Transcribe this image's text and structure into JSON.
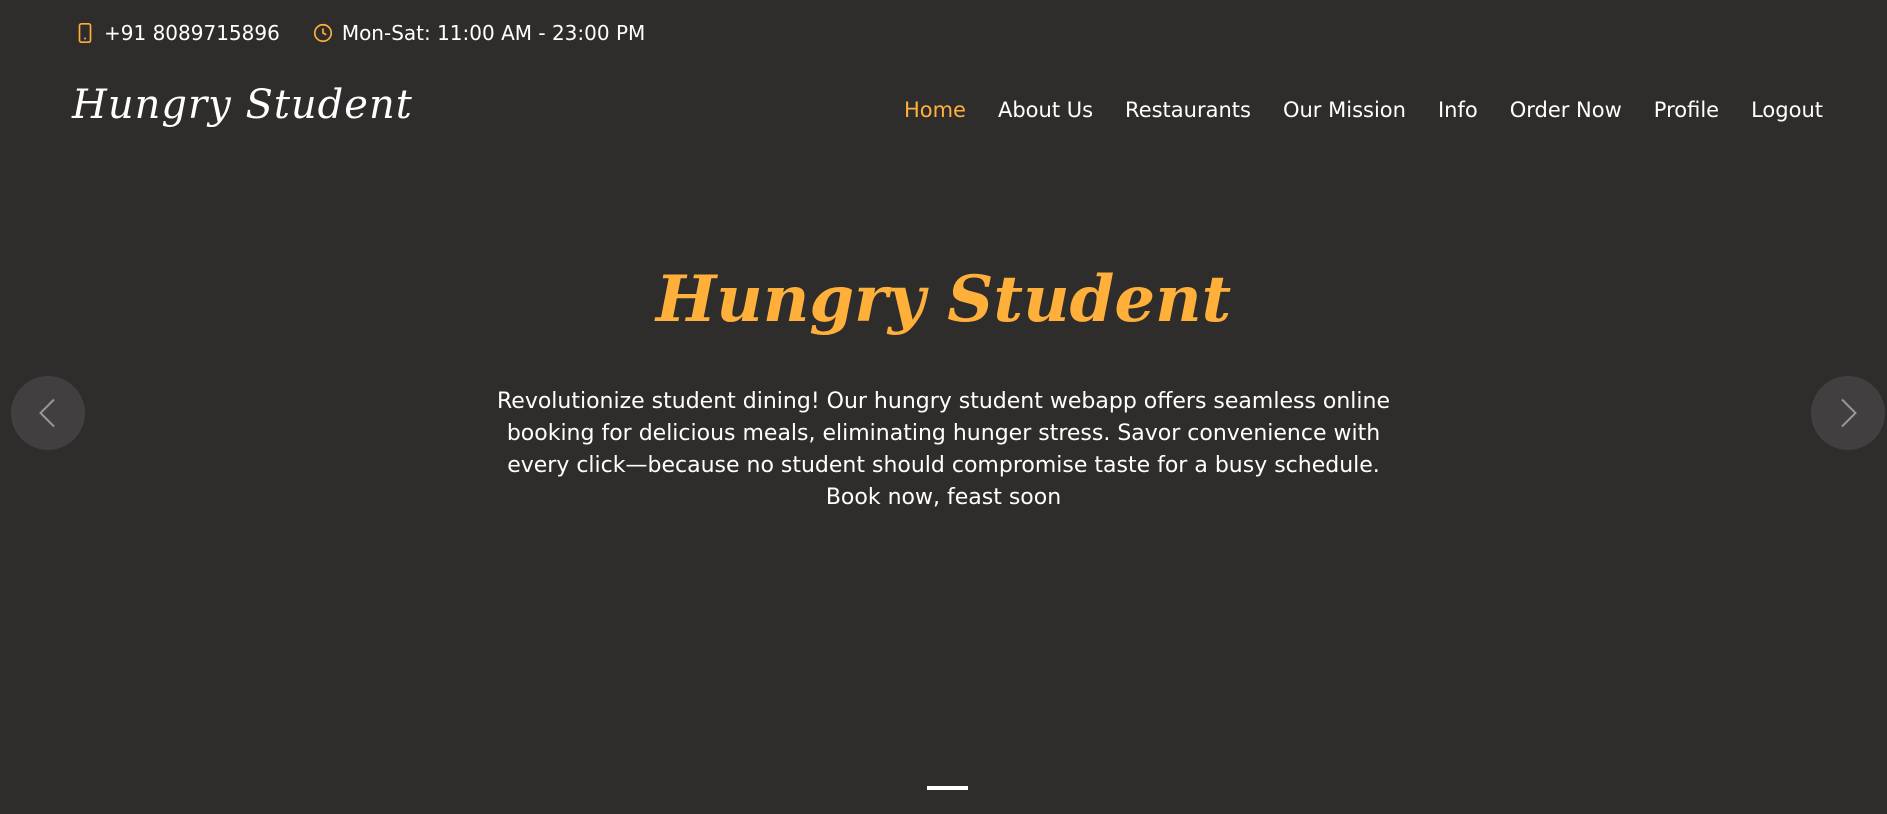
{
  "topbar": {
    "phone": "+91 8089715896",
    "phone_icon": "phone-icon",
    "hours": "Mon-Sat: 11:00 AM - 23:00 PM",
    "hours_icon": "clock-icon"
  },
  "header": {
    "logo": "Hungry Student",
    "nav": [
      {
        "label": "Home",
        "active": true
      },
      {
        "label": "About Us"
      },
      {
        "label": "Restaurants"
      },
      {
        "label": "Our Mission"
      },
      {
        "label": "Info"
      },
      {
        "label": "Order Now"
      },
      {
        "label": "Profile"
      },
      {
        "label": "Logout"
      }
    ]
  },
  "hero": {
    "title": "Hungry Student",
    "description": "Revolutionize student dining! Our hungry student webapp offers seamless online booking for delicious meals, eliminating hunger stress. Savor convenience with every click—because no student should compromise taste for a busy schedule. Book now, feast soon"
  },
  "carousel": {
    "prev_icon": "chevron-left-icon",
    "next_icon": "chevron-right-icon"
  },
  "colors": {
    "background": "#2f2d2c",
    "accent": "#ffb03b",
    "text": "#ffffff"
  }
}
